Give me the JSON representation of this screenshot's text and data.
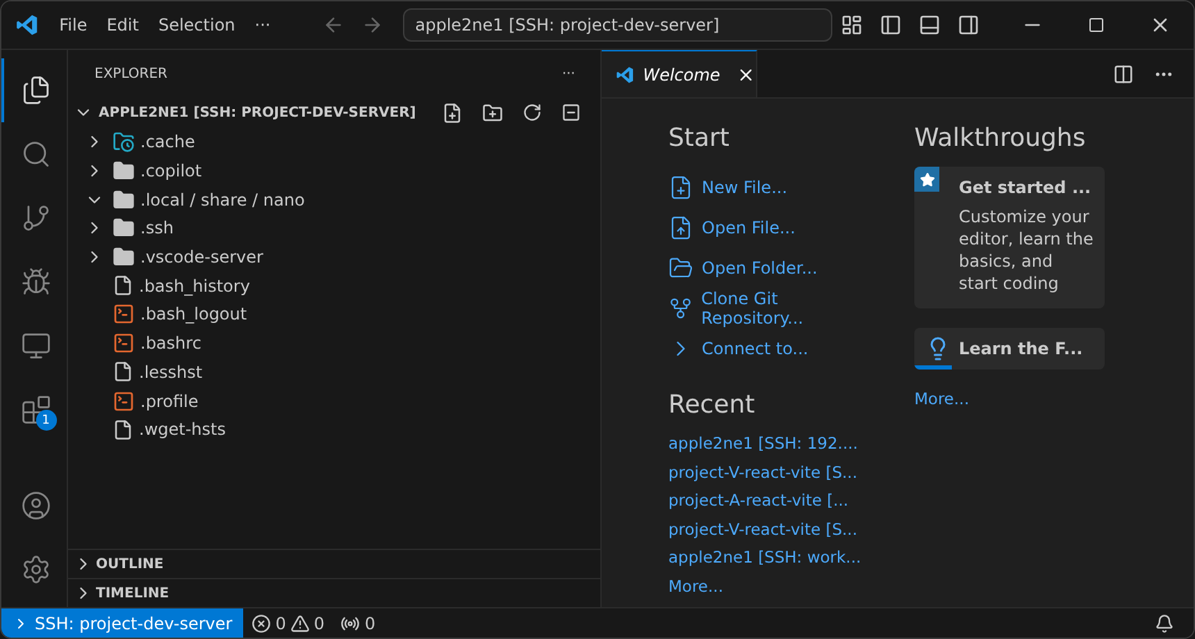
{
  "title_bar": {
    "menu": [
      "File",
      "Edit",
      "Selection",
      "···"
    ],
    "command_center": "apple2ne1 [SSH: project-dev-server]"
  },
  "activity_bar": {
    "items": [
      {
        "kind": "explorer",
        "selected": true
      },
      {
        "kind": "search",
        "selected": false
      },
      {
        "kind": "source-control",
        "selected": false
      },
      {
        "kind": "run",
        "selected": false
      },
      {
        "kind": "remote",
        "selected": false
      },
      {
        "kind": "extensions",
        "selected": false,
        "badge": "1"
      }
    ],
    "bottom": [
      {
        "kind": "account"
      },
      {
        "kind": "settings"
      }
    ]
  },
  "explorer": {
    "title": "EXPLORER",
    "more": "···",
    "root": {
      "label": "APPLE2NE1 [SSH: PROJECT-DEV-SERVER]",
      "expanded": true
    },
    "items": [
      {
        "name": ".cache",
        "kind": "special-folder",
        "expanded": false
      },
      {
        "name": ".copilot",
        "kind": "folder",
        "expanded": false
      },
      {
        "name": ".local / share / nano",
        "kind": "folder",
        "expanded": true
      },
      {
        "name": ".ssh",
        "kind": "folder",
        "expanded": false
      },
      {
        "name": ".vscode-server",
        "kind": "folder",
        "expanded": false
      },
      {
        "name": ".bash_history",
        "kind": "file"
      },
      {
        "name": ".bash_logout",
        "kind": "shell"
      },
      {
        "name": ".bashrc",
        "kind": "shell"
      },
      {
        "name": ".lesshst",
        "kind": "file"
      },
      {
        "name": ".profile",
        "kind": "shell"
      },
      {
        "name": ".wget-hsts",
        "kind": "file"
      }
    ],
    "panels": [
      {
        "label": "OUTLINE",
        "expanded": false
      },
      {
        "label": "TIMELINE",
        "expanded": false
      }
    ]
  },
  "editor": {
    "tabs": [
      {
        "label": "Welcome",
        "selected": true
      }
    ],
    "welcome": {
      "start_title": "Start",
      "start": [
        {
          "label": "New File...",
          "kind": "new-file"
        },
        {
          "label": "Open File...",
          "kind": "open-file"
        },
        {
          "label": "Open Folder...",
          "kind": "open-folder"
        },
        {
          "label": "Clone Git Repository...",
          "kind": "clone"
        },
        {
          "label": "Connect to...",
          "kind": "connect"
        }
      ],
      "recent_title": "Recent",
      "recent": [
        "apple2ne1 [SSH: 192....",
        "project-V-react-vite [S...",
        "project-A-react-vite [...",
        "project-V-react-vite [S...",
        "apple2ne1 [SSH: work..."
      ],
      "recent_more": "More...",
      "walkthroughs_title": "Walkthroughs",
      "walkthroughs": [
        {
          "kind": "featured",
          "title": "Get started ...",
          "description": "Customize your editor, learn the basics, and start coding"
        },
        {
          "kind": "progress",
          "title": "Learn the F...",
          "level": 0.2
        }
      ],
      "walkthroughs_more": "More..."
    }
  },
  "status_bar": {
    "remote": "SSH: project-dev-server",
    "errors": "0",
    "warnings": "0",
    "ports": "0"
  }
}
